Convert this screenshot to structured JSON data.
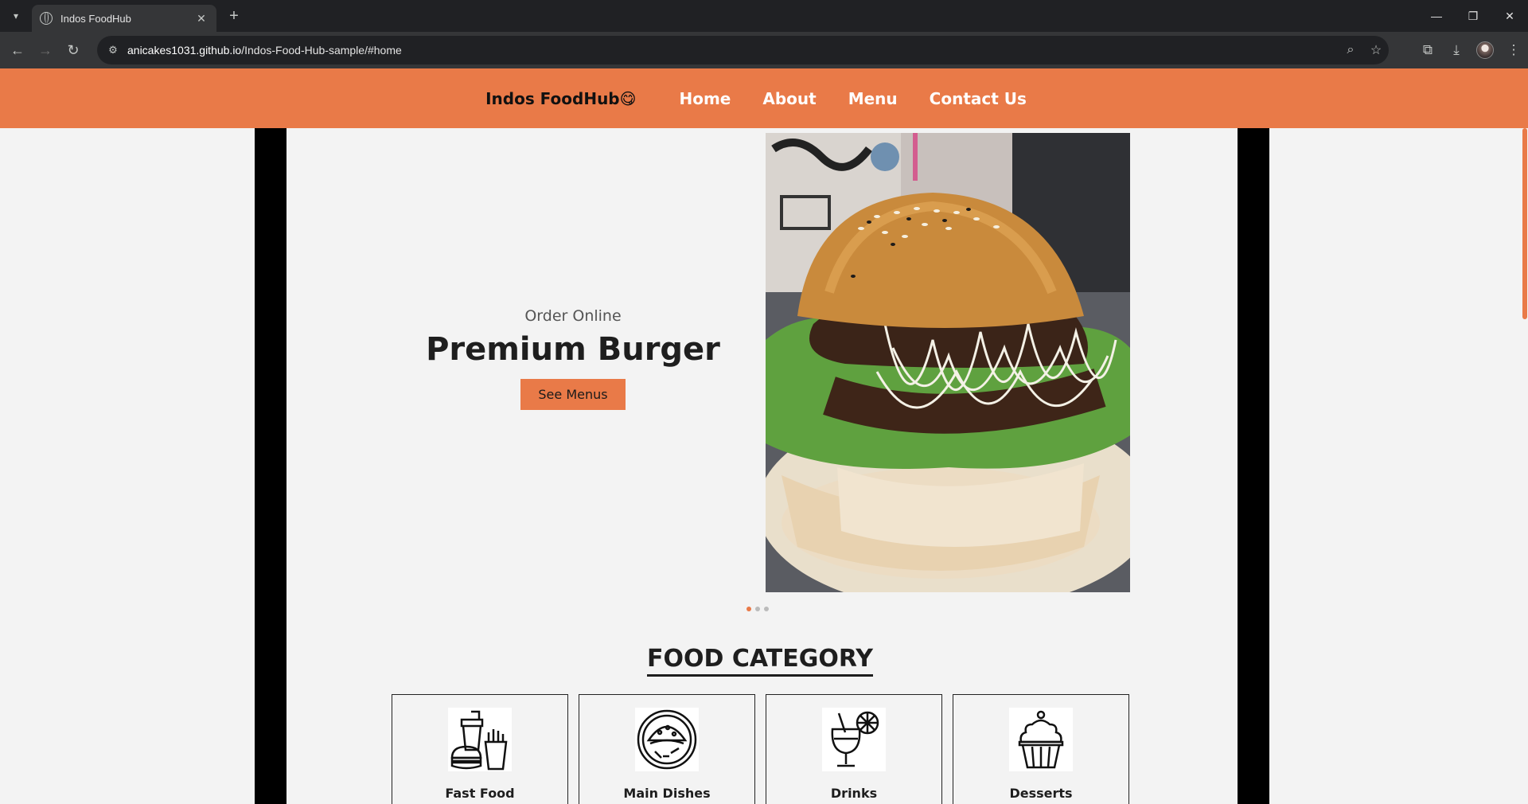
{
  "browser": {
    "tab_title": "Indos FoodHub",
    "url_host": "anicakes1031.github.io",
    "url_path": "/Indos-Food-Hub-sample/#home"
  },
  "site": {
    "brand": "Indos FoodHub😋",
    "nav": [
      "Home",
      "About",
      "Menu",
      "Contact Us"
    ]
  },
  "hero": {
    "subtitle": "Order Online",
    "title": "Premium Burger",
    "button": "See Menus",
    "slide_count": 3,
    "active_slide": 1
  },
  "category": {
    "heading": "FOOD CATEGORY",
    "items": [
      {
        "label": "Fast Food",
        "icon": "fast-food-icon"
      },
      {
        "label": "Main Dishes",
        "icon": "taco-plate-icon"
      },
      {
        "label": "Drinks",
        "icon": "cocktail-icon"
      },
      {
        "label": "Desserts",
        "icon": "cupcake-icon"
      }
    ]
  },
  "colors": {
    "accent": "#e97a48",
    "background": "#f3f3f3",
    "frame": "#000000"
  }
}
